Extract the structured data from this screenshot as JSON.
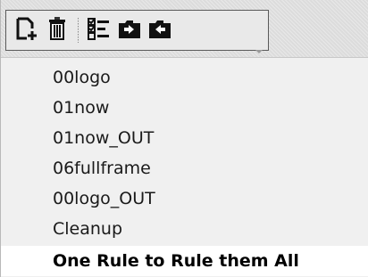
{
  "toolbar": {
    "buttons": [
      {
        "icon": "new-document-icon"
      },
      {
        "icon": "trash-icon"
      },
      {
        "icon": "checklist-icon"
      },
      {
        "icon": "folder-in-icon"
      },
      {
        "icon": "folder-out-icon"
      }
    ]
  },
  "rules": {
    "items": [
      {
        "label": "00logo"
      },
      {
        "label": "01now"
      },
      {
        "label": "01now_OUT"
      },
      {
        "label": "06fullframe"
      },
      {
        "label": "00logo_OUT"
      },
      {
        "label": "Cleanup"
      },
      {
        "label": "One Rule to Rule them All",
        "selected": true
      }
    ]
  },
  "colors": {
    "toolbar_bg": "#e9e9e9",
    "toolbar_border": "#5a5a5a",
    "selected_bg": "#ffffff",
    "text": "#1a1a1a"
  }
}
